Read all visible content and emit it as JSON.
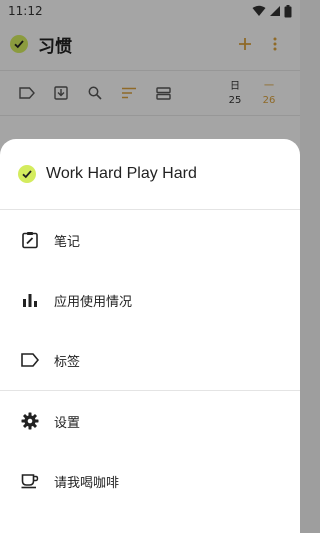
{
  "status_bar": {
    "time": "11:12"
  },
  "app_bar": {
    "title": "习惯"
  },
  "toolbar": {
    "days": [
      {
        "weekday": "日",
        "date": "25"
      },
      {
        "weekday": "一",
        "date": "26"
      }
    ]
  },
  "sheet": {
    "title": "Work Hard Play Hard",
    "items": [
      {
        "label": "笔记",
        "icon": "edit-note-icon"
      },
      {
        "label": "应用使用情况",
        "icon": "bar-chart-icon"
      },
      {
        "label": "标签",
        "icon": "label-icon"
      },
      {
        "label": "设置",
        "icon": "gear-icon"
      },
      {
        "label": "请我喝咖啡",
        "icon": "coffee-cup-icon"
      }
    ]
  },
  "colors": {
    "accent": "#d4ec5e",
    "highlight": "#d9a13d",
    "scrim": "rgba(0,0,0,0.34)"
  }
}
